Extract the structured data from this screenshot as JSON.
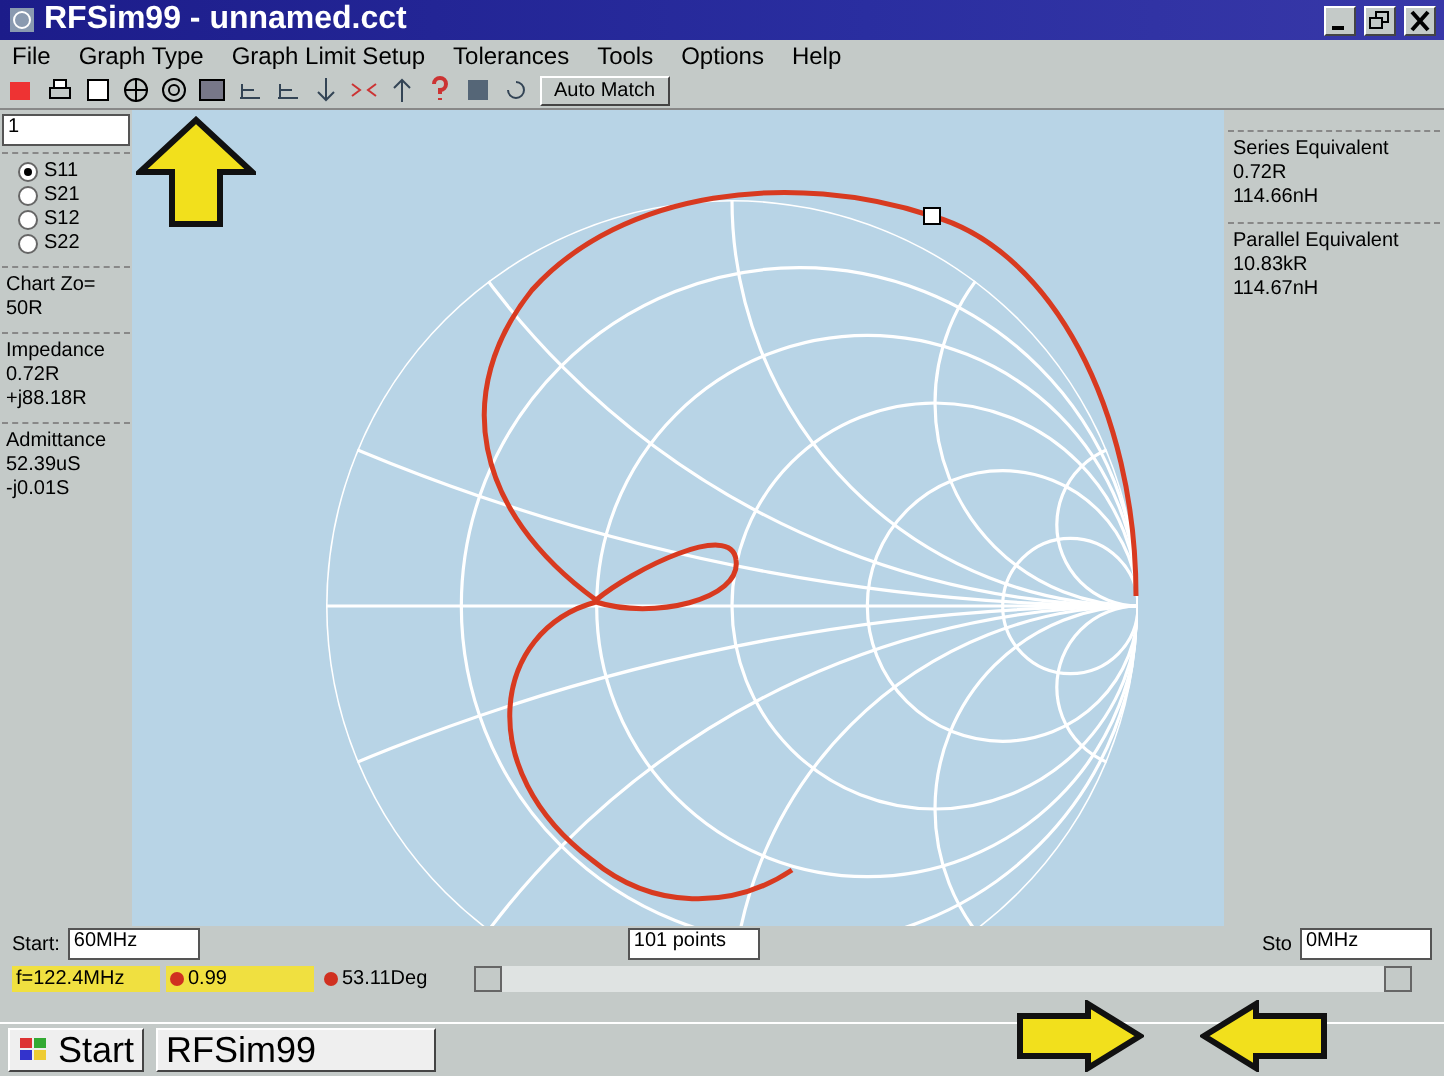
{
  "window": {
    "title": "RFSim99 - unnamed.cct"
  },
  "menu": [
    {
      "label": "File"
    },
    {
      "label": "Graph Type"
    },
    {
      "label": "Graph Limit Setup"
    },
    {
      "label": "Tolerances"
    },
    {
      "label": "Tools"
    },
    {
      "label": "Options"
    },
    {
      "label": "Help"
    }
  ],
  "toolbar": {
    "button": "Auto Match"
  },
  "left_panel": {
    "index_field": {
      "value": "1"
    },
    "parameters": [
      {
        "label": "S11",
        "selected": true
      },
      {
        "label": "S21",
        "selected": false
      },
      {
        "label": "S12",
        "selected": false
      },
      {
        "label": "S22",
        "selected": false
      }
    ],
    "chart_zo": {
      "label": "Chart Zo=",
      "value": "50R"
    },
    "impedance": {
      "title": "Impedance",
      "values": [
        "0.72R",
        "+j88.18R"
      ]
    },
    "admittance": {
      "title": "Admittance",
      "values": [
        "52.39uS",
        "-j0.01S"
      ]
    }
  },
  "right_panel": [
    {
      "title": "Series Equivalent",
      "values": [
        "0.72R",
        "114.66nH"
      ]
    },
    {
      "title": "Parallel Equivalent",
      "values": [
        "10.83kR",
        "114.67nH"
      ]
    }
  ],
  "sweep": {
    "start_label": "Start:",
    "start_value": "60MHz",
    "points": "101 points",
    "stop_label": "Sto",
    "stop_value": "0MHz"
  },
  "status": [
    {
      "text": "f=122.4MHz",
      "marker": false
    },
    {
      "text": "0.99",
      "marker": true
    },
    {
      "text": "53.11Deg",
      "marker": true
    }
  ],
  "taskbar": {
    "start": "Start",
    "task": "RFSim99"
  }
}
